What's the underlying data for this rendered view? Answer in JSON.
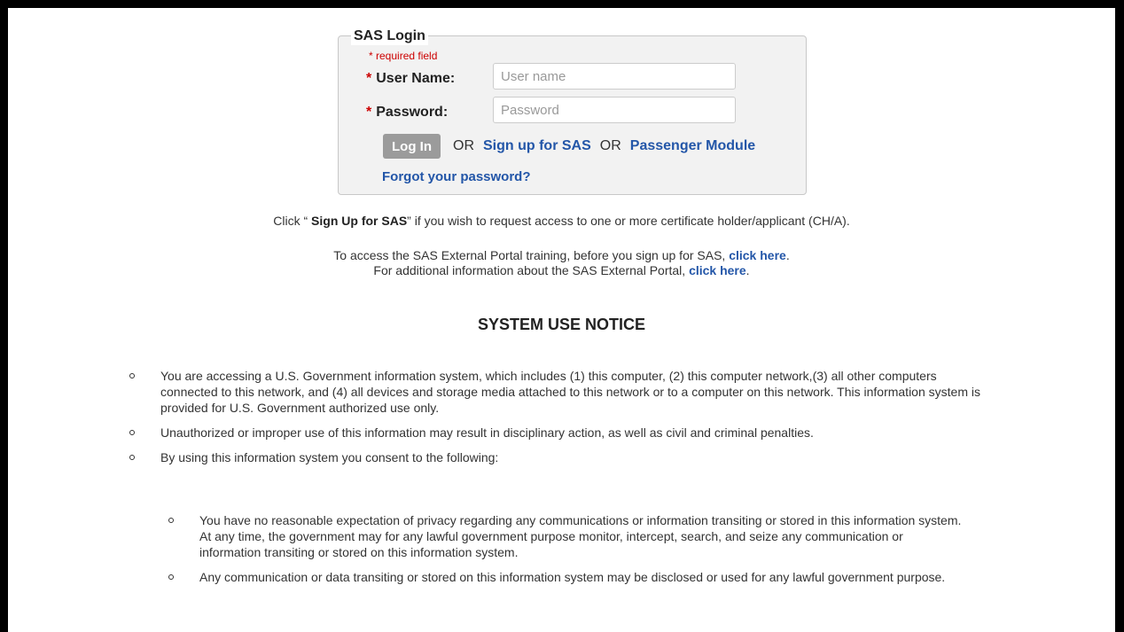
{
  "login": {
    "legend": "SAS Login",
    "required_note": "required field",
    "required_mark": "*",
    "username_label": "User Name:",
    "username_placeholder": "User name",
    "password_label": "Password:",
    "password_placeholder": "Password",
    "login_button": "Log In",
    "or_1": "OR",
    "signup_link": "Sign up for SAS",
    "or_2": "OR",
    "passenger_link": "Passenger Module",
    "forgot_link": "Forgot your password?"
  },
  "info": {
    "signup_prefix": "Click “ ",
    "signup_bold": "Sign Up for SAS",
    "signup_suffix": "” if you wish to request access to one or more certificate holder/applicant (CH/A).",
    "training_text": "To access the SAS External Portal training, before you sign up for SAS, ",
    "training_link": "click here",
    "training_end": ".",
    "additional_text": "For additional information about the SAS External Portal, ",
    "additional_link": "click here",
    "additional_end": "."
  },
  "notice": {
    "heading": "SYSTEM USE NOTICE",
    "items": [
      "You are accessing a U.S. Government information system, which includes (1) this computer, (2) this computer network,(3) all other computers connected to this network, and (4) all devices and storage media attached to this network or to a computer on this network. This information system is provided for U.S. Government authorized use only.",
      "Unauthorized or improper use of this information may result in disciplinary action, as well as civil and criminal penalties.",
      "By using this information system you consent to the following:"
    ],
    "sub_items": [
      "You have no reasonable expectation of privacy regarding any communications or information transiting or stored in this information system. At any time, the government may for any lawful government purpose monitor, intercept, search, and seize any communication or information transiting or stored on this information system.",
      "Any communication or data transiting or stored on this information system may be disclosed or used for any lawful government purpose."
    ]
  }
}
